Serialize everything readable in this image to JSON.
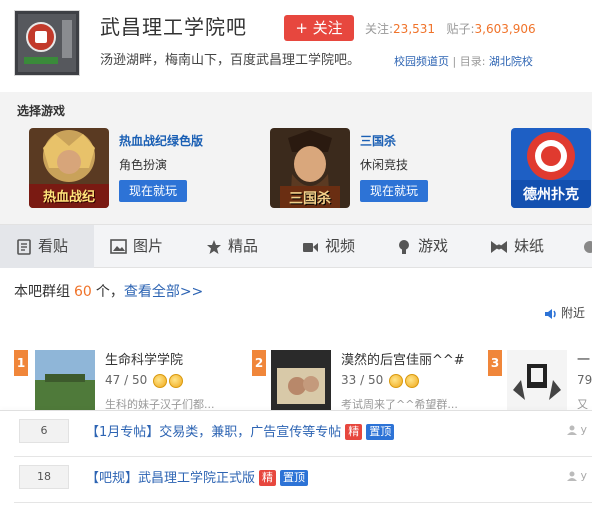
{
  "header": {
    "title": "武昌理工学院吧",
    "follow_label": "+ 关注",
    "follow_count_label": "关注:",
    "follow_count": "23,531",
    "posts_label": "贴子:",
    "posts_count": "3,603,906",
    "slogan": "汤逊湖畔，梅南山下，百度武昌理工学院吧。",
    "link_channel": "校园频道页",
    "directory_label": "| 目录:",
    "link_directory": "湖北院校"
  },
  "games": {
    "section_title": "选择游戏",
    "items": [
      {
        "name": "热血战纪绿色版",
        "category": "角色扮演",
        "play_label": "现在就玩",
        "logo_text": "热血战纪"
      },
      {
        "name": "三国杀",
        "category": "休闲竞技",
        "play_label": "现在就玩",
        "logo_text": "三国杀"
      },
      {
        "name": "",
        "category": "",
        "play_label": "",
        "logo_text": "德州扑克"
      }
    ]
  },
  "nav": {
    "tabs": [
      {
        "label": "看贴",
        "icon": "doc-icon",
        "active": true
      },
      {
        "label": "图片",
        "icon": "picture-icon"
      },
      {
        "label": "精品",
        "icon": "star-icon"
      },
      {
        "label": "视频",
        "icon": "video-icon"
      },
      {
        "label": "游戏",
        "icon": "gamepad-icon"
      },
      {
        "label": "妹纸",
        "icon": "bow-icon"
      }
    ]
  },
  "groups_bar": {
    "prefix": "本吧群组",
    "count": "60",
    "suffix": "个，",
    "view_all": "查看全部>>",
    "nearby": "附近"
  },
  "groups": [
    {
      "rank": "1",
      "name": "生命科学学院",
      "members": "47 / 50",
      "desc": "生科的妹子汉子们都..."
    },
    {
      "rank": "2",
      "name": "漠然的后宫佳丽^^#",
      "members": "33 / 50",
      "desc": "考试周来了^^希望群..."
    },
    {
      "rank": "3",
      "name": "一",
      "members": "79",
      "desc": "又"
    }
  ],
  "threads": [
    {
      "replies": "6",
      "title": "【1月专帖】交易类，兼职，广告宣传等专帖",
      "badges": [
        "精",
        "置顶"
      ],
      "author": "y"
    },
    {
      "replies": "18",
      "title": "【吧规】武昌理工学院正式版",
      "badges": [
        "精",
        "置顶"
      ],
      "author": "y"
    }
  ],
  "colors": {
    "accent": "#e7473e",
    "link": "#2d64b3",
    "button": "#2d73d6",
    "number": "#f0732a"
  }
}
